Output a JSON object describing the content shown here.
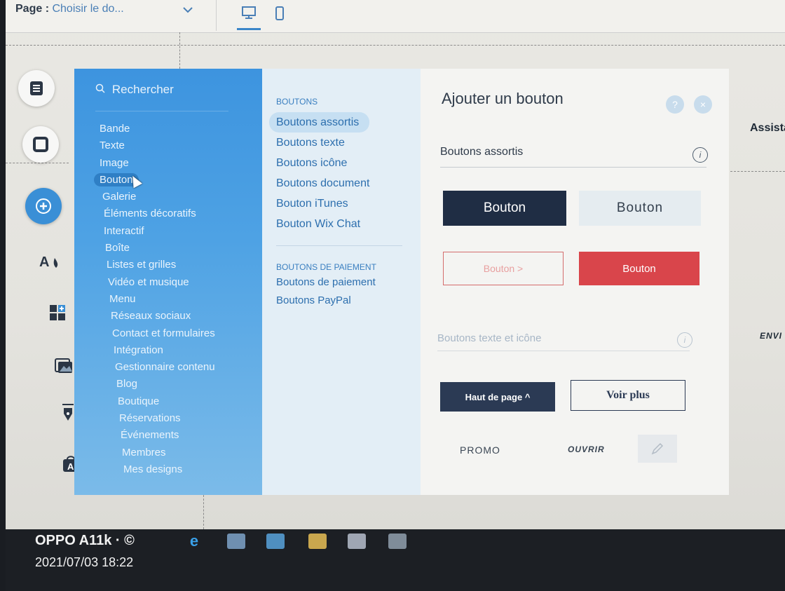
{
  "topbar": {
    "page_label": "Page :",
    "page_value": "Choisir le do...",
    "chevron_icon": "chevron-down-icon",
    "desktop_icon": "desktop-icon",
    "mobile_icon": "mobile-icon"
  },
  "left_rail": {
    "items": [
      {
        "icon": "pages-icon",
        "glyph": "▤"
      },
      {
        "icon": "background-icon",
        "glyph": "▢"
      },
      {
        "icon": "add-icon",
        "glyph": "+"
      },
      {
        "icon": "theme-icon",
        "glyph": "A"
      },
      {
        "icon": "apps-icon",
        "glyph": "▦"
      },
      {
        "icon": "media-icon",
        "glyph": "▣"
      },
      {
        "icon": "blog-pen-icon",
        "glyph": "✒"
      },
      {
        "icon": "store-icon",
        "glyph": "A"
      }
    ]
  },
  "categories": {
    "search_placeholder": "Rechercher",
    "items": [
      "Bande",
      "Texte",
      "Image",
      "Bouton",
      "Galerie",
      "Éléments décoratifs",
      "Interactif",
      "Boîte",
      "Listes et grilles",
      "Vidéo et musique",
      "Menu",
      "Réseaux sociaux",
      "Contact et formulaires",
      "Intégration",
      "Gestionnaire contenu",
      "Blog",
      "Boutique",
      "Réservations",
      "Événements",
      "Membres",
      "Mes designs"
    ],
    "selected": "Bouton"
  },
  "subcategories": {
    "heading1": "BOUTONS",
    "group1": [
      "Boutons assortis",
      "Boutons texte",
      "Boutons icône",
      "Boutons document",
      "Bouton iTunes",
      "Bouton Wix Chat"
    ],
    "heading2": "BOUTONS DE PAIEMENT",
    "group2": [
      "Boutons de paiement",
      "Boutons PayPal"
    ]
  },
  "main": {
    "title": "Ajouter un bouton",
    "help": "?",
    "close": "×",
    "section1": "Boutons assortis",
    "section2": "Boutons texte et icône",
    "info": "i",
    "btn_dark": "Bouton",
    "btn_light": "Bouton",
    "btn_outline_red": "Bouton >",
    "btn_red": "Bouton",
    "btn_top": "Haut de page ^",
    "btn_more": "Voir plus",
    "btn_promo": "PROMO",
    "btn_open": "OUVRIR",
    "pencil_icon": "pencil-icon"
  },
  "right": {
    "assist": "Assista",
    "envi": "ENVI"
  },
  "colors": {
    "panel_blue": "#3d94df",
    "link_blue": "#2d6fae",
    "dark_button": "#1f2d44",
    "red_button": "#d9454b"
  },
  "photo_overlay": {
    "device": "OPPO A11k · ©",
    "timestamp": "2021/07/03 18:22"
  }
}
